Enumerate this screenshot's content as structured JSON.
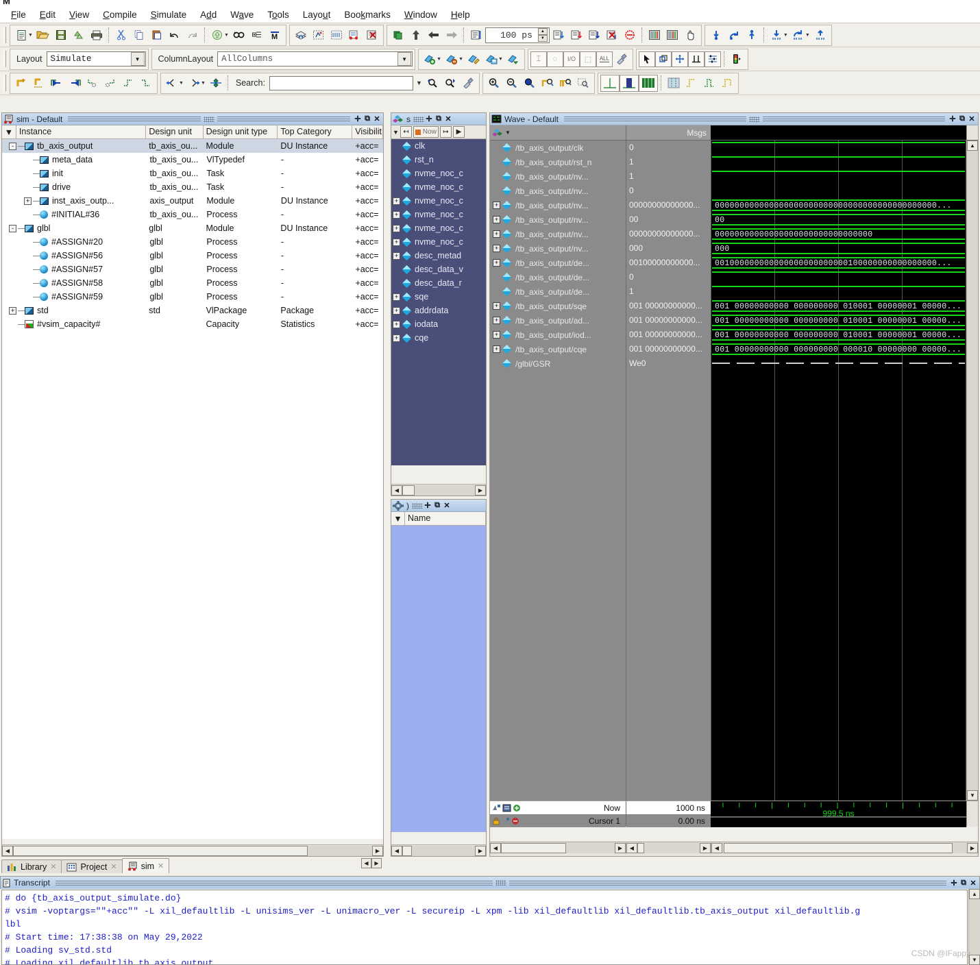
{
  "window": {
    "title_glyph": "M"
  },
  "menu": [
    {
      "label": "File",
      "accel": "F"
    },
    {
      "label": "Edit",
      "accel": "E"
    },
    {
      "label": "View",
      "accel": "V"
    },
    {
      "label": "Compile",
      "accel": "C"
    },
    {
      "label": "Simulate",
      "accel": "S"
    },
    {
      "label": "Add",
      "accel": "d"
    },
    {
      "label": "Wave",
      "accel": "a"
    },
    {
      "label": "Tools",
      "accel": "o"
    },
    {
      "label": "Layout",
      "accel": "u"
    },
    {
      "label": "Bookmarks",
      "accel": "k"
    },
    {
      "label": "Window",
      "accel": "W"
    },
    {
      "label": "Help",
      "accel": "H"
    }
  ],
  "toolbar_row1": {
    "groups": [
      {
        "name": "file-group",
        "icons": [
          "new-file-icon",
          "dropdown-arrow",
          "open-folder-icon",
          "save-icon",
          "reload-icon",
          "print-icon",
          "sep",
          "cut-icon",
          "copy-icon",
          "paste-icon",
          "undo-icon",
          "redo-icon",
          "sep",
          "compile-icon",
          "dropdown-arrow",
          "find-icon",
          "expand-tree-icon",
          "mark-icon"
        ]
      },
      {
        "name": "simulate-group",
        "icons": [
          "compile-all-icon",
          "simulate-icon",
          "simulate-opt-icon",
          "breakpoint-icon",
          "remove-break-icon"
        ]
      },
      {
        "name": "run-group",
        "icons": [
          "restart-icon",
          "step-up-icon",
          "step-back-icon",
          "step-forward-icon",
          "sep",
          "run-icon"
        ]
      },
      {
        "name": "run-length",
        "value": "100 ps"
      },
      {
        "name": "run-ctl-group",
        "icons": [
          "run-all-icon",
          "continue-icon",
          "step-icon",
          "break-icon",
          "stop-icon",
          "sep",
          "wave-cmp-icon",
          "wave-cmp2-icon",
          "hand-icon"
        ]
      },
      {
        "name": "step-group",
        "icons": [
          "step-into-icon",
          "step-over-icon",
          "step-out-icon",
          "sep",
          "step-into-instr-icon",
          "dropdown-arrow",
          "step-over-instr-icon",
          "dropdown-arrow",
          "step-out-instr-icon"
        ]
      }
    ],
    "run_length": "100 ps"
  },
  "toolbar_row2": {
    "layout_label": "Layout",
    "layout_value": "Simulate",
    "columnlayout_label": "ColumnLayout",
    "columnlayout_value": "AllColumns",
    "icons": [
      "add-wave-icon",
      "dropdown-arrow",
      "remove-wave-icon",
      "dropdown-arrow",
      "edit-wave-icon",
      "save-wave-icon",
      "dropdown-arrow",
      "load-wave-icon",
      "sep",
      "insert-cursor-icon",
      "toggle-leaf-icon",
      "io-icon",
      "select-region-icon",
      "all-icon",
      "clean-icon",
      "sep",
      "pointer-icon",
      "select-mode-icon",
      "pan-mode-icon",
      "marker-icon",
      "signal-filter-icon",
      "sep",
      "traffic-icon"
    ]
  },
  "toolbar_row3": {
    "search_label": "Search:",
    "search_value": "",
    "search_placeholder": "",
    "left_icons": [
      "add-bookmark-icon",
      "clear-bookmark-icon",
      "prev-transition-icon",
      "next-transition-icon",
      "find-prev-icon",
      "find-next-icon",
      "find-falling-icon",
      "find-rising-icon"
    ],
    "mid_icons": [
      "expand-left-icon",
      "dropdown-arrow",
      "collapse-right-icon",
      "dropdown-arrow",
      "expand-all-icon"
    ],
    "zoom_icons": [
      "zoom-in-icon",
      "zoom-out-icon",
      "zoom-full-icon",
      "zoom-cursor-icon",
      "zoom-range-icon",
      "zoom-select-icon"
    ],
    "view_icons": [
      "wave-single-icon",
      "wave-dual-icon",
      "wave-multi-icon",
      "sep",
      "grid-icon",
      "rise-icon",
      "fall-icon",
      "both-icon"
    ]
  },
  "sim_panel": {
    "title": "sim - Default",
    "icon": "sim-icon",
    "buttons": [
      "undock-icon",
      "maximize-icon",
      "close-icon"
    ],
    "columns": [
      "Instance",
      "Design unit",
      "Design unit type",
      "Top Category",
      "Visibilit"
    ],
    "rows": [
      {
        "indent": 0,
        "twisty": "-",
        "icon": "module-icon",
        "instance": "tb_axis_output",
        "design_unit": "tb_axis_ou...",
        "type": "Module",
        "category": "DU Instance",
        "visibility": "+acc=",
        "selected": true
      },
      {
        "indent": 1,
        "twisty": "",
        "icon": "module-icon",
        "instance": "meta_data",
        "design_unit": "tb_axis_ou...",
        "type": "VlTypedef",
        "category": "-",
        "visibility": "+acc=",
        "selected": false
      },
      {
        "indent": 1,
        "twisty": "",
        "icon": "module-icon",
        "instance": "init",
        "design_unit": "tb_axis_ou...",
        "type": "Task",
        "category": "-",
        "visibility": "+acc=",
        "selected": false
      },
      {
        "indent": 1,
        "twisty": "",
        "icon": "module-icon",
        "instance": "drive",
        "design_unit": "tb_axis_ou...",
        "type": "Task",
        "category": "-",
        "visibility": "+acc=",
        "selected": false
      },
      {
        "indent": 1,
        "twisty": "+",
        "icon": "module-icon",
        "instance": "inst_axis_outp...",
        "design_unit": "axis_output",
        "type": "Module",
        "category": "DU Instance",
        "visibility": "+acc=",
        "selected": false
      },
      {
        "indent": 1,
        "twisty": "",
        "icon": "process-icon",
        "instance": "#INITIAL#36",
        "design_unit": "tb_axis_ou...",
        "type": "Process",
        "category": "-",
        "visibility": "+acc=",
        "selected": false
      },
      {
        "indent": 0,
        "twisty": "-",
        "icon": "module-icon",
        "instance": "glbl",
        "design_unit": "glbl",
        "type": "Module",
        "category": "DU Instance",
        "visibility": "+acc=",
        "selected": false
      },
      {
        "indent": 1,
        "twisty": "",
        "icon": "process-icon",
        "instance": "#ASSIGN#20",
        "design_unit": "glbl",
        "type": "Process",
        "category": "-",
        "visibility": "+acc=",
        "selected": false
      },
      {
        "indent": 1,
        "twisty": "",
        "icon": "process-icon",
        "instance": "#ASSIGN#56",
        "design_unit": "glbl",
        "type": "Process",
        "category": "-",
        "visibility": "+acc=",
        "selected": false
      },
      {
        "indent": 1,
        "twisty": "",
        "icon": "process-icon",
        "instance": "#ASSIGN#57",
        "design_unit": "glbl",
        "type": "Process",
        "category": "-",
        "visibility": "+acc=",
        "selected": false
      },
      {
        "indent": 1,
        "twisty": "",
        "icon": "process-icon",
        "instance": "#ASSIGN#58",
        "design_unit": "glbl",
        "type": "Process",
        "category": "-",
        "visibility": "+acc=",
        "selected": false
      },
      {
        "indent": 1,
        "twisty": "",
        "icon": "process-icon",
        "instance": "#ASSIGN#59",
        "design_unit": "glbl",
        "type": "Process",
        "category": "-",
        "visibility": "+acc=",
        "selected": false
      },
      {
        "indent": 0,
        "twisty": "+",
        "icon": "module-icon",
        "instance": "std",
        "design_unit": "std",
        "type": "VlPackage",
        "category": "Package",
        "visibility": "+acc=",
        "selected": false
      },
      {
        "indent": 0,
        "twisty": "",
        "icon": "capacity-icon",
        "instance": "#vsim_capacity#",
        "design_unit": "",
        "type": "Capacity",
        "category": "Statistics",
        "visibility": "+acc=",
        "selected": false
      }
    ]
  },
  "objects_panel": {
    "title": "s",
    "buttons": [
      "undock-icon",
      "maximize-icon",
      "close-icon"
    ],
    "toolbar": {
      "filter": "filter-icon",
      "prev": "prev-icon",
      "now_label": "Now",
      "next": "next-icon",
      "more": "more-icon"
    },
    "items": [
      {
        "plus": false,
        "label": "clk"
      },
      {
        "plus": false,
        "label": "rst_n"
      },
      {
        "plus": false,
        "label": "nvme_noc_c"
      },
      {
        "plus": false,
        "label": "nvme_noc_c"
      },
      {
        "plus": true,
        "label": "nvme_noc_c"
      },
      {
        "plus": true,
        "label": "nvme_noc_c"
      },
      {
        "plus": true,
        "label": "nvme_noc_c"
      },
      {
        "plus": true,
        "label": "nvme_noc_c"
      },
      {
        "plus": true,
        "label": "desc_metad"
      },
      {
        "plus": false,
        "label": "desc_data_v"
      },
      {
        "plus": false,
        "label": "desc_data_r"
      },
      {
        "plus": true,
        "label": "sqe"
      },
      {
        "plus": true,
        "label": "addrdata"
      },
      {
        "plus": true,
        "label": "iodata"
      },
      {
        "plus": true,
        "label": "cqe"
      }
    ]
  },
  "processes_panel": {
    "title": ")",
    "icon": "gear-icon",
    "buttons": [
      "undock-icon",
      "maximize-icon",
      "close-icon"
    ],
    "column": "Name",
    "rows": []
  },
  "wave_panel": {
    "title": "Wave - Default",
    "icon": "wave-icon",
    "buttons": [
      "undock-icon",
      "maximize-icon",
      "close-icon"
    ],
    "value_column_header": "Msgs",
    "signals": [
      {
        "plus": false,
        "name": "/tb_axis_output/clk",
        "value": "0",
        "render": "line",
        "y": 2
      },
      {
        "plus": false,
        "name": "/tb_axis_output/rst_n",
        "value": "1",
        "render": "line",
        "y": 2
      },
      {
        "plus": false,
        "name": "/tb_axis_output/nv...",
        "value": "1",
        "render": "line",
        "y": 2
      },
      {
        "plus": false,
        "name": "/tb_axis_output/nv...",
        "value": "0",
        "render": "none",
        "y": 18
      },
      {
        "plus": true,
        "name": "/tb_axis_output/nv...",
        "value": "00000000000000...",
        "render": "bus",
        "wave_text": "000000000000000000000000000000000000000000000..."
      },
      {
        "plus": true,
        "name": "/tb_axis_output/nv...",
        "value": "00",
        "render": "bus",
        "wave_text": "00"
      },
      {
        "plus": true,
        "name": "/tb_axis_output/nv...",
        "value": "00000000000000...",
        "render": "bus",
        "wave_text": "00000000000000000000000000000000"
      },
      {
        "plus": true,
        "name": "/tb_axis_output/nv...",
        "value": "000",
        "render": "bus",
        "wave_text": "000"
      },
      {
        "plus": true,
        "name": "/tb_axis_output/de...",
        "value": "00100000000000...",
        "render": "bus",
        "wave_text": "001000000000000000000000000100000000000000000..."
      },
      {
        "plus": false,
        "name": "/tb_axis_output/de...",
        "value": "0",
        "render": "line",
        "y": 2
      },
      {
        "plus": false,
        "name": "/tb_axis_output/de...",
        "value": "1",
        "render": "line",
        "y": 2
      },
      {
        "plus": true,
        "name": "/tb_axis_output/sqe",
        "value": "001 00000000000...",
        "render": "bus",
        "wave_text": "001 00000000000 000000000 010001 00000001 00000..."
      },
      {
        "plus": true,
        "name": "/tb_axis_output/ad...",
        "value": "001 00000000000...",
        "render": "bus",
        "wave_text": "001 00000000000 000000000 010001 00000001 00000..."
      },
      {
        "plus": true,
        "name": "/tb_axis_output/iod...",
        "value": "001 00000000000...",
        "render": "bus",
        "wave_text": "001 00000000000 000000000 010001 00000001 00000..."
      },
      {
        "plus": true,
        "name": "/tb_axis_output/cqe",
        "value": "001 00000000000...",
        "render": "bus",
        "wave_text": "001 00000000000 000000000 000010 00000000 00000..."
      },
      {
        "plus": false,
        "name": "/glbl/GSR",
        "value": "We0",
        "render": "dash",
        "y": 9
      }
    ],
    "footer": {
      "now_label": "Now",
      "now_value": "1000 ns",
      "cursor_label": "Cursor 1",
      "cursor_value": "0.00 ns",
      "timeline_label": "999.5 ns"
    }
  },
  "bottom_tabs": [
    {
      "label": "Library",
      "icon": "library-icon",
      "active": false
    },
    {
      "label": "Project",
      "icon": "project-icon",
      "active": false
    },
    {
      "label": "sim",
      "icon": "sim-icon",
      "active": true
    }
  ],
  "transcript": {
    "title": "Transcript",
    "icon": "transcript-icon",
    "buttons": [
      "undock-icon",
      "maximize-icon",
      "close-icon"
    ],
    "lines": [
      "# do {tb_axis_output_simulate.do}",
      "# vsim -voptargs=\"\"+acc\"\" -L xil_defaultlib -L unisims_ver -L unimacro_ver -L secureip -L xpm -lib xil_defaultlib xil_defaultlib.tb_axis_output xil_defaultlib.g",
      "lbl",
      "# Start time: 17:38:38 on May 29,2022",
      "# Loading sv_std.std",
      "# Loading xil_defaultlib.tb_axis_output"
    ]
  },
  "watermark": "CSDN @IFappy",
  "colors": {
    "wave_green": "#19d419",
    "wave_bg": "#000000",
    "panel_title": "#aec8e4",
    "objects_bg": "#4a4f7a",
    "transcript_text": "#1b1bc8"
  }
}
